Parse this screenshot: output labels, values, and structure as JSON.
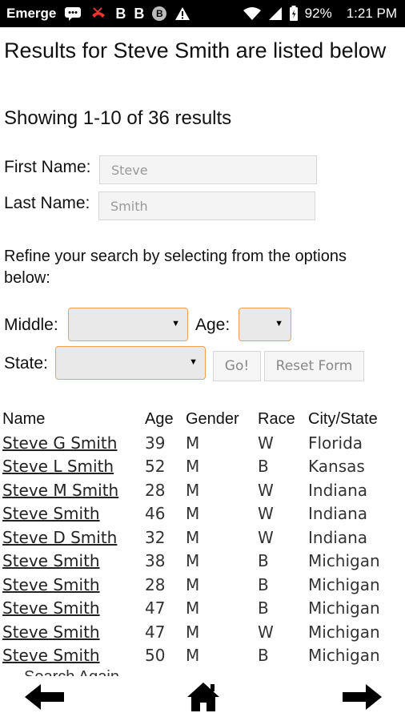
{
  "status_bar": {
    "app_text": "Emerge",
    "battery": "92%",
    "time": "1:21 PM",
    "icons": [
      "message-icon",
      "missed-call-icon",
      "b-icon",
      "b-icon",
      "b-circle-icon",
      "warning-icon",
      "wifi-icon",
      "signal-icon",
      "battery-icon"
    ]
  },
  "header": {
    "title": "Results for Steve Smith are listed below",
    "showing": "Showing 1-10 of 36 results"
  },
  "form": {
    "first_name_label": "First Name:",
    "first_name_value": "Steve",
    "last_name_label": "Last Name:",
    "last_name_value": "Smith",
    "refine_text": "Refine your search by selecting from the options below:",
    "middle_label": "Middle:",
    "age_label": "Age:",
    "state_label": "State:",
    "go_label": "Go!",
    "reset_label": "Reset Form"
  },
  "table": {
    "headers": [
      "Name",
      "Age",
      "Gender",
      "Race",
      "City/State"
    ],
    "rows": [
      {
        "name": "Steve G Smith",
        "age": "39",
        "gender": "M",
        "race": "W",
        "city": "Florida"
      },
      {
        "name": "Steve L Smith",
        "age": "52",
        "gender": "M",
        "race": "B",
        "city": "Kansas"
      },
      {
        "name": "Steve M Smith",
        "age": "28",
        "gender": "M",
        "race": "W",
        "city": "Indiana"
      },
      {
        "name": "Steve Smith",
        "age": "46",
        "gender": "M",
        "race": "W",
        "city": "Indiana"
      },
      {
        "name": "Steve D Smith",
        "age": "32",
        "gender": "M",
        "race": "W",
        "city": "Indiana"
      },
      {
        "name": "Steve Smith",
        "age": "38",
        "gender": "M",
        "race": "B",
        "city": "Michigan"
      },
      {
        "name": "Steve Smith",
        "age": "28",
        "gender": "M",
        "race": "B",
        "city": "Michigan"
      },
      {
        "name": "Steve Smith",
        "age": "47",
        "gender": "M",
        "race": "B",
        "city": "Michigan"
      },
      {
        "name": "Steve Smith",
        "age": "47",
        "gender": "M",
        "race": "W",
        "city": "Michigan"
      },
      {
        "name": "Steve Smith",
        "age": "50",
        "gender": "M",
        "race": "B",
        "city": "Michigan"
      }
    ]
  },
  "footer": {
    "search_again": "Search Again"
  },
  "nav": {
    "icons": [
      "back-arrow-icon",
      "home-icon",
      "forward-arrow-icon"
    ]
  },
  "colors": {
    "status_bar_bg": "#000000",
    "select_border": "#f0a055",
    "field_bg": "#f4f4f4"
  }
}
